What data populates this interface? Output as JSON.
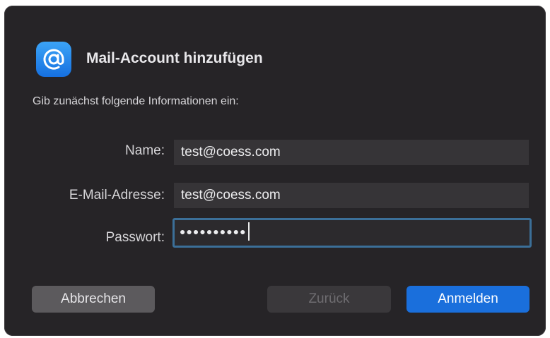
{
  "dialog": {
    "title": "Mail-Account hinzufügen",
    "subtitle": "Gib zunächst folgende Informationen ein:",
    "app_icon": "at-sign-icon",
    "accent_color": "#1a6fdc"
  },
  "form": {
    "name_label": "Name:",
    "name_value": "test@coess.com",
    "email_label": "E-Mail-Adresse:",
    "email_value": "test@coess.com",
    "password_label": "Passwort:",
    "password_masked": "●●●●●●●●●●"
  },
  "buttons": {
    "cancel_label": "Abbrechen",
    "back_label": "Zurück",
    "login_label": "Anmelden"
  }
}
